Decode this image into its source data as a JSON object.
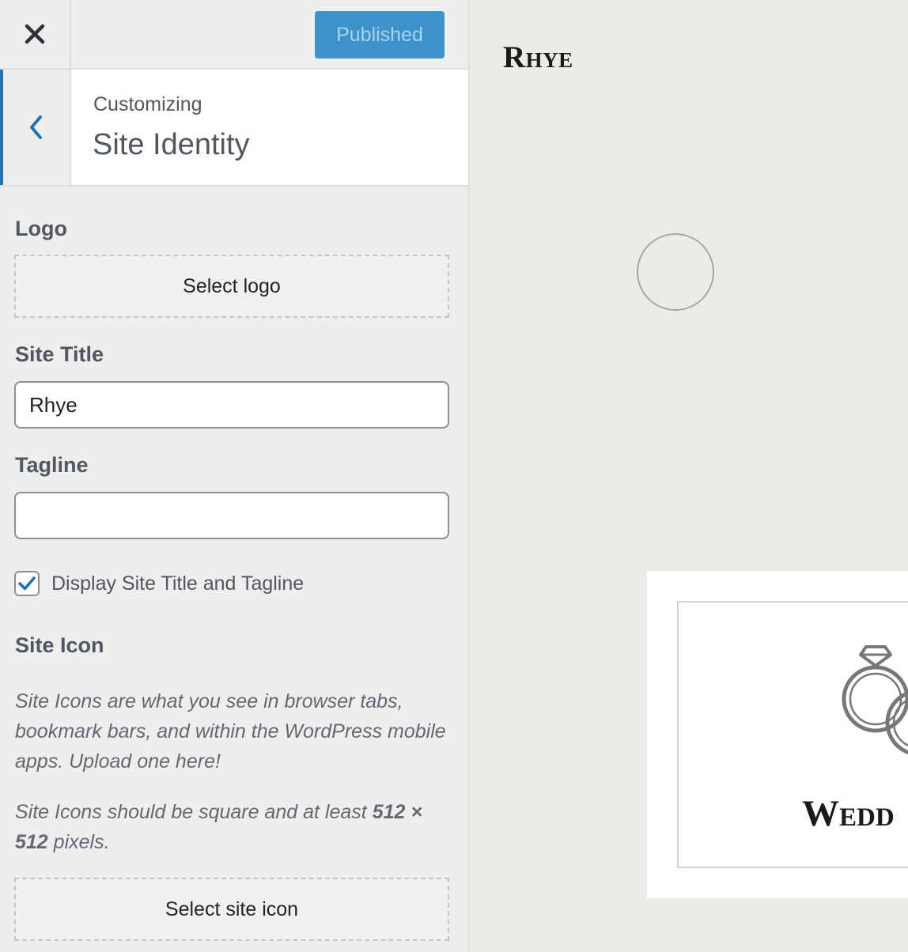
{
  "header": {
    "publish_label": "Published"
  },
  "section": {
    "customizing_label": "Customizing",
    "title": "Site Identity"
  },
  "logo": {
    "label": "Logo",
    "button_label": "Select logo"
  },
  "site_title": {
    "label": "Site Title",
    "value": "Rhye"
  },
  "tagline": {
    "label": "Tagline",
    "value": ""
  },
  "display_toggle": {
    "label": "Display Site Title and Tagline",
    "checked": true
  },
  "site_icon": {
    "label": "Site Icon",
    "description_1": "Site Icons are what you see in browser tabs, bookmark bars, and within the WordPress mobile apps. Upload one here!",
    "description_2_prefix": "Site Icons should be square and at least ",
    "description_2_size": "512 × 512",
    "description_2_suffix": " pixels.",
    "button_label": "Select site icon"
  },
  "preview": {
    "site_title": "Rhye",
    "card_title": "Wedd"
  },
  "colors": {
    "accent": "#2271b1",
    "publish_bg": "#3d93c9"
  }
}
